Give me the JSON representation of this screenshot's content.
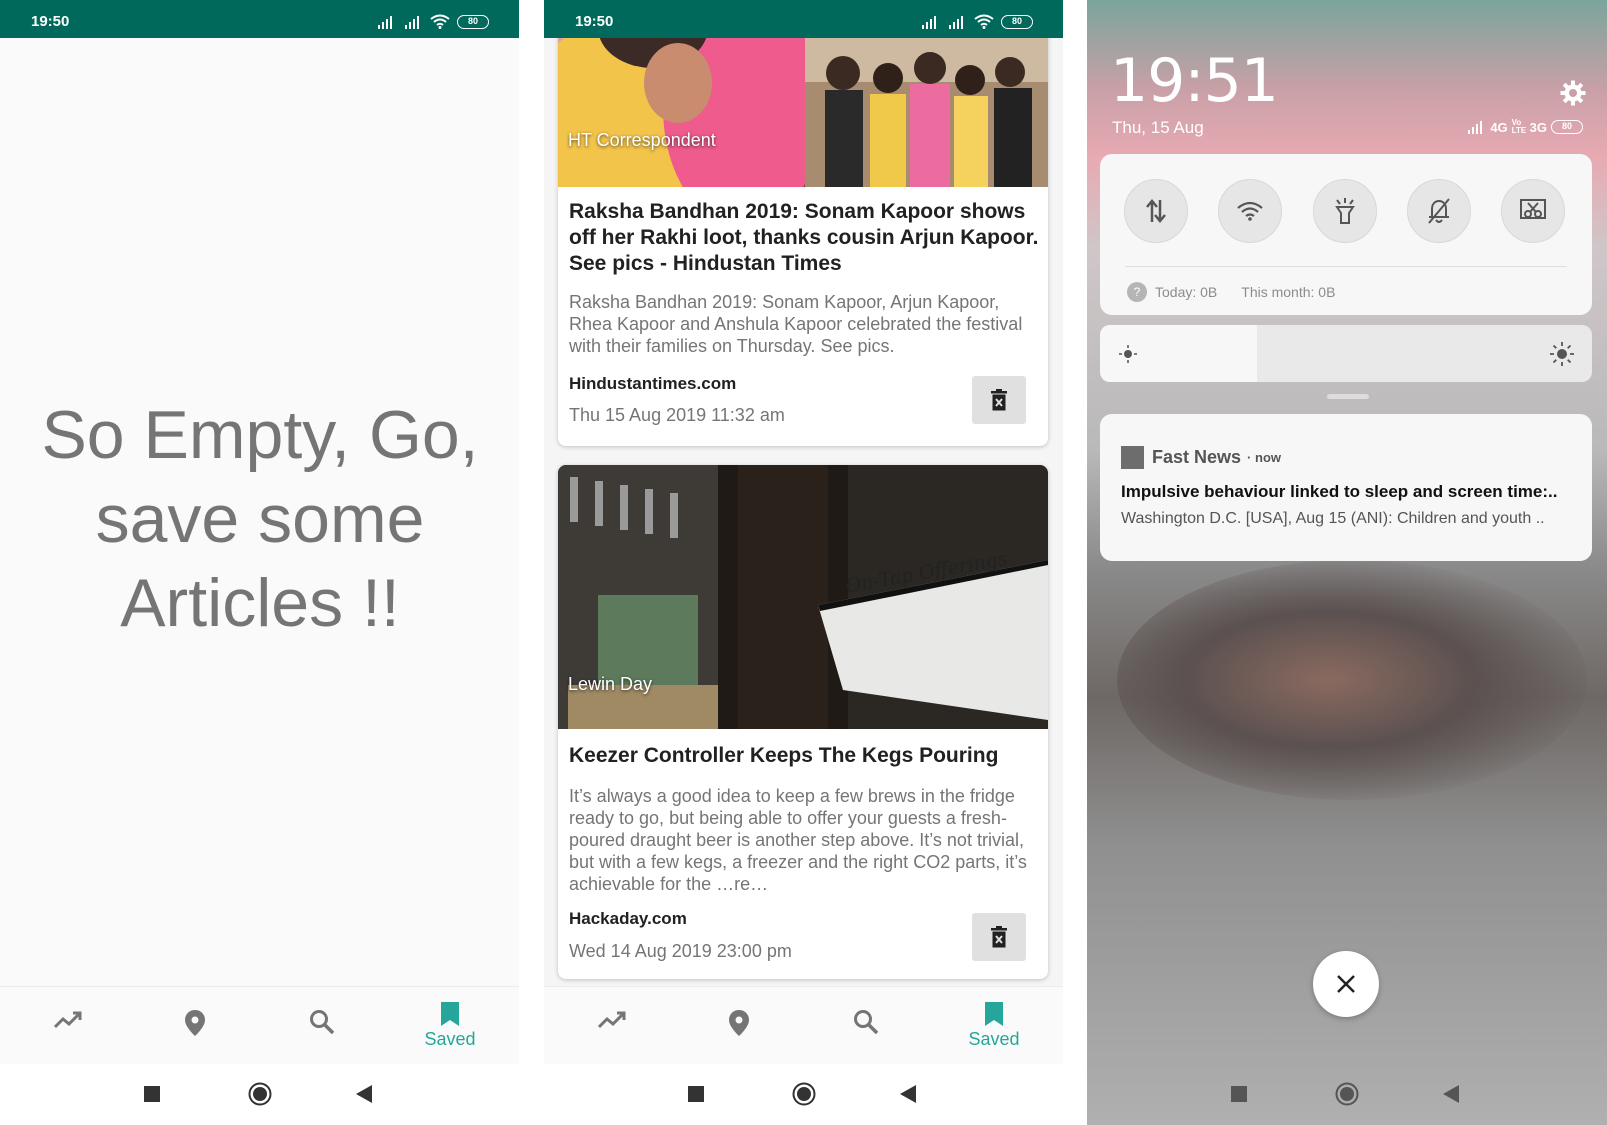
{
  "status": {
    "time": "19:50",
    "battery": "80"
  },
  "empty_message": "So Empty, Go, save some Articles !!",
  "nav": {
    "saved_label": "Saved"
  },
  "articles": [
    {
      "author": "HT Correspondent",
      "title": "Raksha Bandhan 2019: Sonam Kapoor shows off her Rakhi loot, thanks cousin Arjun Kapoor. See pics - Hindustan Times",
      "description": "Raksha Bandhan 2019: Sonam Kapoor, Arjun Kapoor, Rhea Kapoor and Anshula Kapoor celebrated the festival with their families on Thursday. See pics.",
      "source": "Hindustantimes.com",
      "date": "Thu 15 Aug 2019 11:32 am"
    },
    {
      "author": "Lewin Day",
      "title": "Keezer Controller Keeps The Kegs Pouring",
      "description": "It’s always a good idea to keep a few brews in the fridge ready to go, but being able to offer your guests a fresh-poured draught beer is another step above. It’s not trivial, but with a few kegs, a freezer and the right CO2 parts, it’s achievable for the …re…",
      "source": "Hackaday.com",
      "date": "Wed 14 Aug 2019 23:00 pm",
      "image_text": "On-Tap Offerings"
    }
  ],
  "lockscreen": {
    "time": "19:51",
    "date": "Thu, 15 Aug",
    "network": {
      "n4g": "4G",
      "volte": "Vo LTE",
      "n3g": "3G",
      "battery": "80"
    },
    "usage": {
      "today": "Today: 0B",
      "month": "This month: 0B"
    },
    "brightness_level": 0.32,
    "notification": {
      "app": "Fast News",
      "when": "now",
      "title": "Impulsive behaviour linked to sleep and screen time:..",
      "body": "Washington D.C. [USA], Aug 15 (ANI): Children and youth .."
    }
  },
  "colors": {
    "status_bar": "#00695c",
    "accent": "#26a69a"
  }
}
